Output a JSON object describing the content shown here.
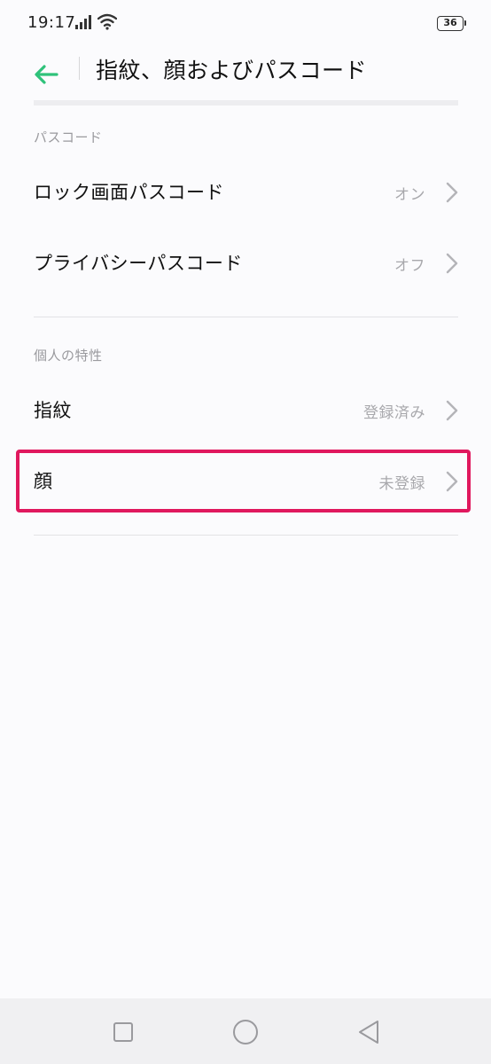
{
  "status_bar": {
    "time": "19:17",
    "battery": "36",
    "icons": [
      "signal-icon",
      "wifi-icon",
      "battery-icon"
    ]
  },
  "header": {
    "title": "指紋、顔およびパスコード",
    "back_icon": "back-arrow-icon"
  },
  "sections": [
    {
      "label": "パスコード",
      "items": [
        {
          "label": "ロック画面パスコード",
          "value": "オン"
        },
        {
          "label": "プライバシーパスコード",
          "value": "オフ"
        }
      ]
    },
    {
      "label": "個人の特性",
      "items": [
        {
          "label": "指紋",
          "value": "登録済み"
        },
        {
          "label": "顔",
          "value": "未登録"
        }
      ]
    }
  ],
  "nav_bar": {
    "buttons": [
      "recents-square-icon",
      "home-circle-icon",
      "back-triangle-icon"
    ]
  },
  "colors": {
    "accent": "#2fc27a",
    "highlight": "#e0185e",
    "background": "#fbfbfd",
    "secondary_text": "#a8a8ac"
  }
}
